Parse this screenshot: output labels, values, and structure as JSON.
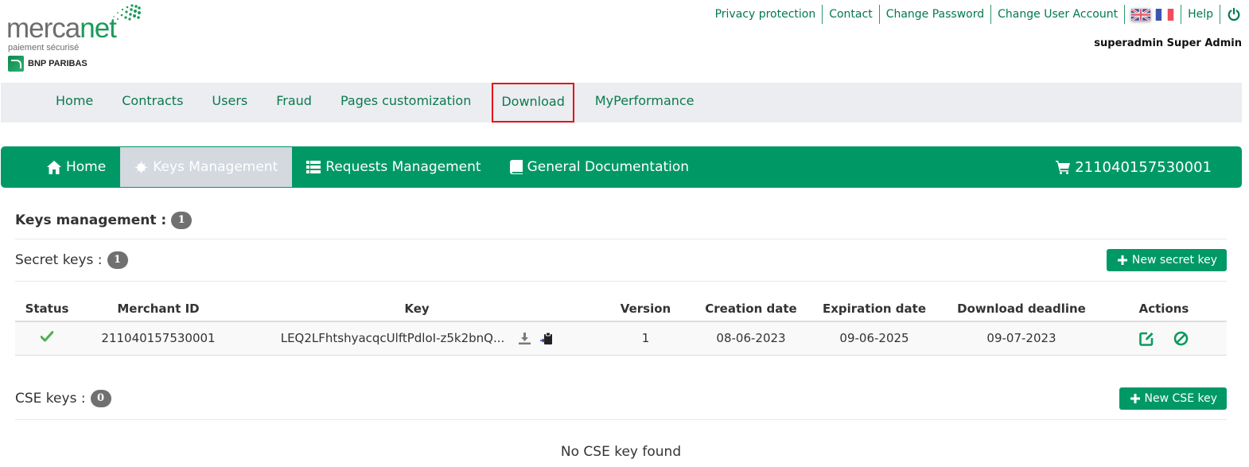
{
  "brand": {
    "name_part1": "merca",
    "name_part2": "net",
    "tagline": "paiement sécurisé",
    "bank": "BNP PARIBAS"
  },
  "top_links": {
    "privacy": "Privacy protection",
    "contact": "Contact",
    "change_password": "Change Password",
    "change_user_account": "Change User Account",
    "help": "Help"
  },
  "user": {
    "display_name": "superadmin Super Admin"
  },
  "main_nav": {
    "items": [
      {
        "label": "Home"
      },
      {
        "label": "Contracts"
      },
      {
        "label": "Users"
      },
      {
        "label": "Fraud"
      },
      {
        "label": "Pages customization"
      },
      {
        "label": "Download"
      },
      {
        "label": "MyPerformance"
      }
    ],
    "highlighted": "Download",
    "highlight_color": "#e3141b"
  },
  "sub_nav": {
    "items": [
      {
        "label": "Home",
        "icon": "home-icon"
      },
      {
        "label": "Keys Management",
        "icon": "asterisk-icon",
        "active": true
      },
      {
        "label": "Requests Management",
        "icon": "list-icon"
      },
      {
        "label": "General Documentation",
        "icon": "book-icon"
      }
    ],
    "merchant_id": "21104015753000​1",
    "merchant_icon": "cart-icon",
    "accent_color": "#009966"
  },
  "keys_management": {
    "title": "Keys management :",
    "count": "1"
  },
  "secret_keys": {
    "title": "Secret keys :",
    "count": "1",
    "new_button": "New secret key",
    "columns": [
      "Status",
      "Merchant ID",
      "Key",
      "Version",
      "Creation date",
      "Expiration date",
      "Download deadline",
      "Actions"
    ],
    "rows": [
      {
        "status": "active",
        "merchant_id": "211040157530001",
        "key": "LEQ2LFhtshyacqcUlftPdloI-z5k2bnQ...",
        "version": "1",
        "creation_date": "08-06-2023",
        "expiration_date": "09-06-2025",
        "download_deadline": "09-07-2023"
      }
    ]
  },
  "cse_keys": {
    "title": "CSE keys :",
    "count": "0",
    "new_button": "New CSE key",
    "empty_message": "No CSE key found"
  }
}
